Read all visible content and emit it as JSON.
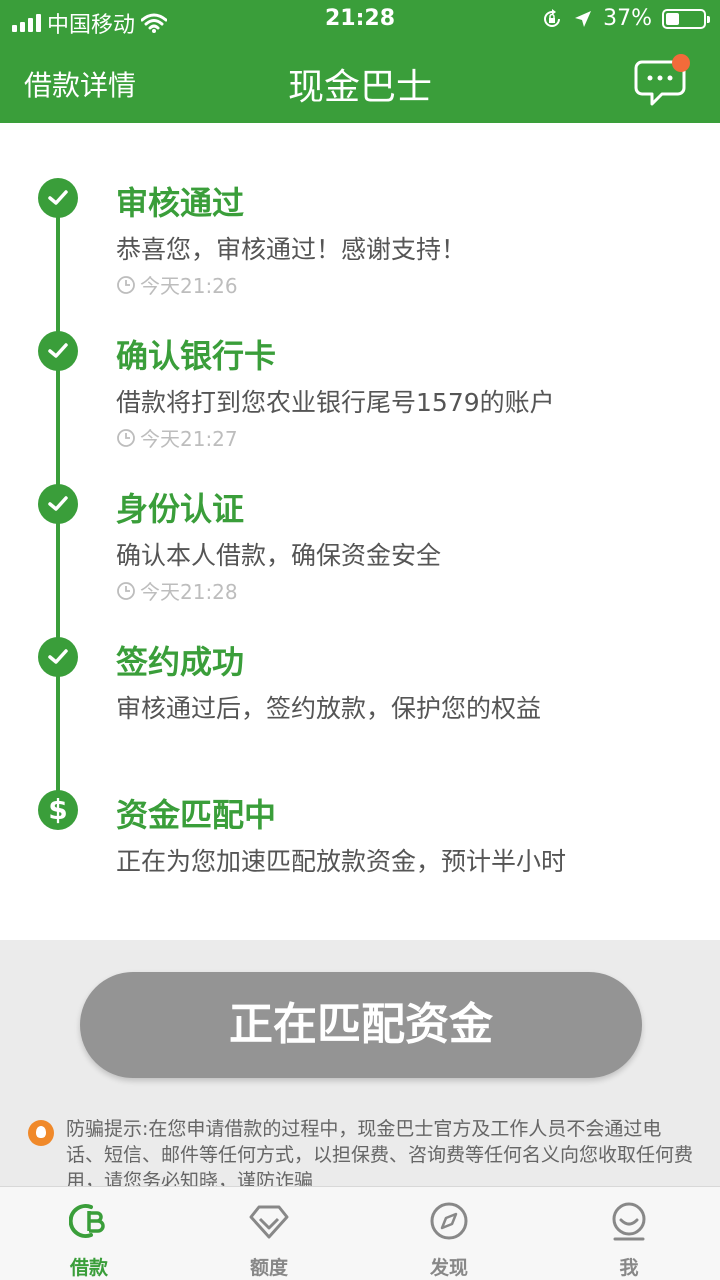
{
  "status_bar": {
    "carrier": "中国移动",
    "time": "21:28",
    "battery": "37%",
    "battery_level": 0.37
  },
  "nav": {
    "back_label": "借款详情",
    "title": "现金巴士",
    "message_icon": "chat-bubble-icon",
    "has_unread": true
  },
  "steps": [
    {
      "title": "审核通过",
      "desc": "恭喜您，审核通过！感谢支持！",
      "time": "今天21:26",
      "icon": "check-icon"
    },
    {
      "title": "确认银行卡",
      "desc": "借款将打到您农业银行尾号1579的账户",
      "time": "今天21:27",
      "icon": "check-icon"
    },
    {
      "title": "身份认证",
      "desc": "确认本人借款，确保资金安全",
      "time": "今天21:28",
      "icon": "check-icon"
    },
    {
      "title": "签约成功",
      "desc": "审核通过后，签约放款，保护您的权益",
      "icon": "check-icon"
    },
    {
      "title": "资金匹配中",
      "desc": "正在为您加速匹配放款资金，预计半小时",
      "icon": "dollar-icon",
      "icon_glyph": "$"
    }
  ],
  "action_button": "正在匹配资金",
  "notice": "防骗提示:在您申请借款的过程中，现金巴士官方及工作人员不会通过电话、短信、邮件等任何方式，以担保费、咨询费等任何名义向您收取任何费用，请您务必知晓，谨防诈骗",
  "tabs": [
    {
      "label": "借款",
      "icon": "loan-icon",
      "active": true
    },
    {
      "label": "额度",
      "icon": "diamond-icon",
      "active": false
    },
    {
      "label": "发现",
      "icon": "compass-icon",
      "active": false
    },
    {
      "label": "我",
      "icon": "smiley-icon",
      "active": false
    }
  ],
  "colors": {
    "accent": "#3a9e3a",
    "badge": "#f26b3a",
    "button_disabled": "#949494",
    "notice_icon": "#f0892a"
  }
}
